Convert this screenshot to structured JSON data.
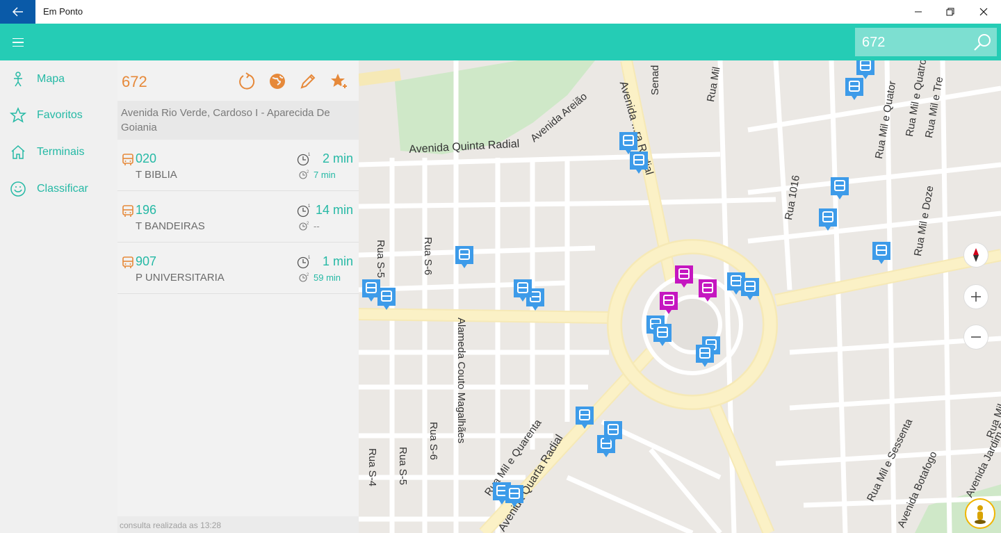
{
  "window": {
    "title": "Em Ponto",
    "back_icon": "back-arrow-icon",
    "controls": [
      "minimize-icon",
      "restore-icon",
      "close-icon"
    ]
  },
  "header": {
    "menu_icon": "hamburger-icon",
    "search": {
      "value": "672",
      "placeholder": "",
      "icon": "search-icon"
    }
  },
  "nav": {
    "items": [
      {
        "label": "Mapa",
        "icon": "person-icon"
      },
      {
        "label": "Favoritos",
        "icon": "star-icon"
      },
      {
        "label": "Terminais",
        "icon": "home-icon"
      },
      {
        "label": "Classificar",
        "icon": "smiley-icon"
      }
    ]
  },
  "stop": {
    "code": "672",
    "address": "Avenida Rio Verde, Cardoso I - Aparecida De Goiania",
    "actions": [
      "refresh-icon",
      "globe-icon",
      "edit-icon",
      "favorite-add-icon"
    ],
    "routes": [
      {
        "number": "020",
        "destination": "T BIBLIA",
        "eta": "2 min",
        "next_eta": "7 min"
      },
      {
        "number": "196",
        "destination": "T BANDEIRAS",
        "eta": "14 min",
        "next_eta": "--"
      },
      {
        "number": "907",
        "destination": "P UNIVERSITARIA",
        "eta": "1 min",
        "next_eta": "59 min"
      }
    ],
    "footer": "consulta realizada as 13:28"
  },
  "map": {
    "street_labels": {
      "avenida_areiao": "Avenida Areião",
      "avenida_quinta_radial": "Avenida Quinta Radial",
      "avenida_radial": "Avenida ...ra Radial",
      "senad": "Senad",
      "rua_mil": "Rua Mil",
      "rua_mil_e_quatorze": "Rua Mil e Quator",
      "rua_mil_e_tre": "Rua Mil e Tre",
      "rua_mil_e_quatro": "Rua Mil e Quatro",
      "rua_mil_e_doze": "Rua Mil e Doze",
      "rua_1016": "Rua 1016",
      "rua_s5_top": "Rua S-5",
      "rua_s6_top": "Rua S-6",
      "alameda_couto": "Alameda Couto Magalhães",
      "rua_s4": "Rua S-4",
      "rua_s5_bottom": "Rua S-5",
      "rua_s6_bottom": "Rua S-6",
      "rua_mil_quarenta": "Rua Mil e Quarenta",
      "avenida_quarta_radial": "Avenida Quarta Radial",
      "rua_mil_sessenta": "Rua Mil e Sessenta",
      "avenida_botafogo": "Avenida Botafogo",
      "avenida_jardim": "Avenida Jardim B",
      "rua_mil_right": "Rua Mil"
    },
    "controls": [
      "compass-icon",
      "zoom-in-icon",
      "zoom-out-icon",
      "streetside-person-icon"
    ],
    "colors": {
      "stop_pin": "#3d9be9",
      "bus_pin": "#c516c0",
      "road_major": "#fbf1c6",
      "park": "#cfe8c8"
    }
  }
}
